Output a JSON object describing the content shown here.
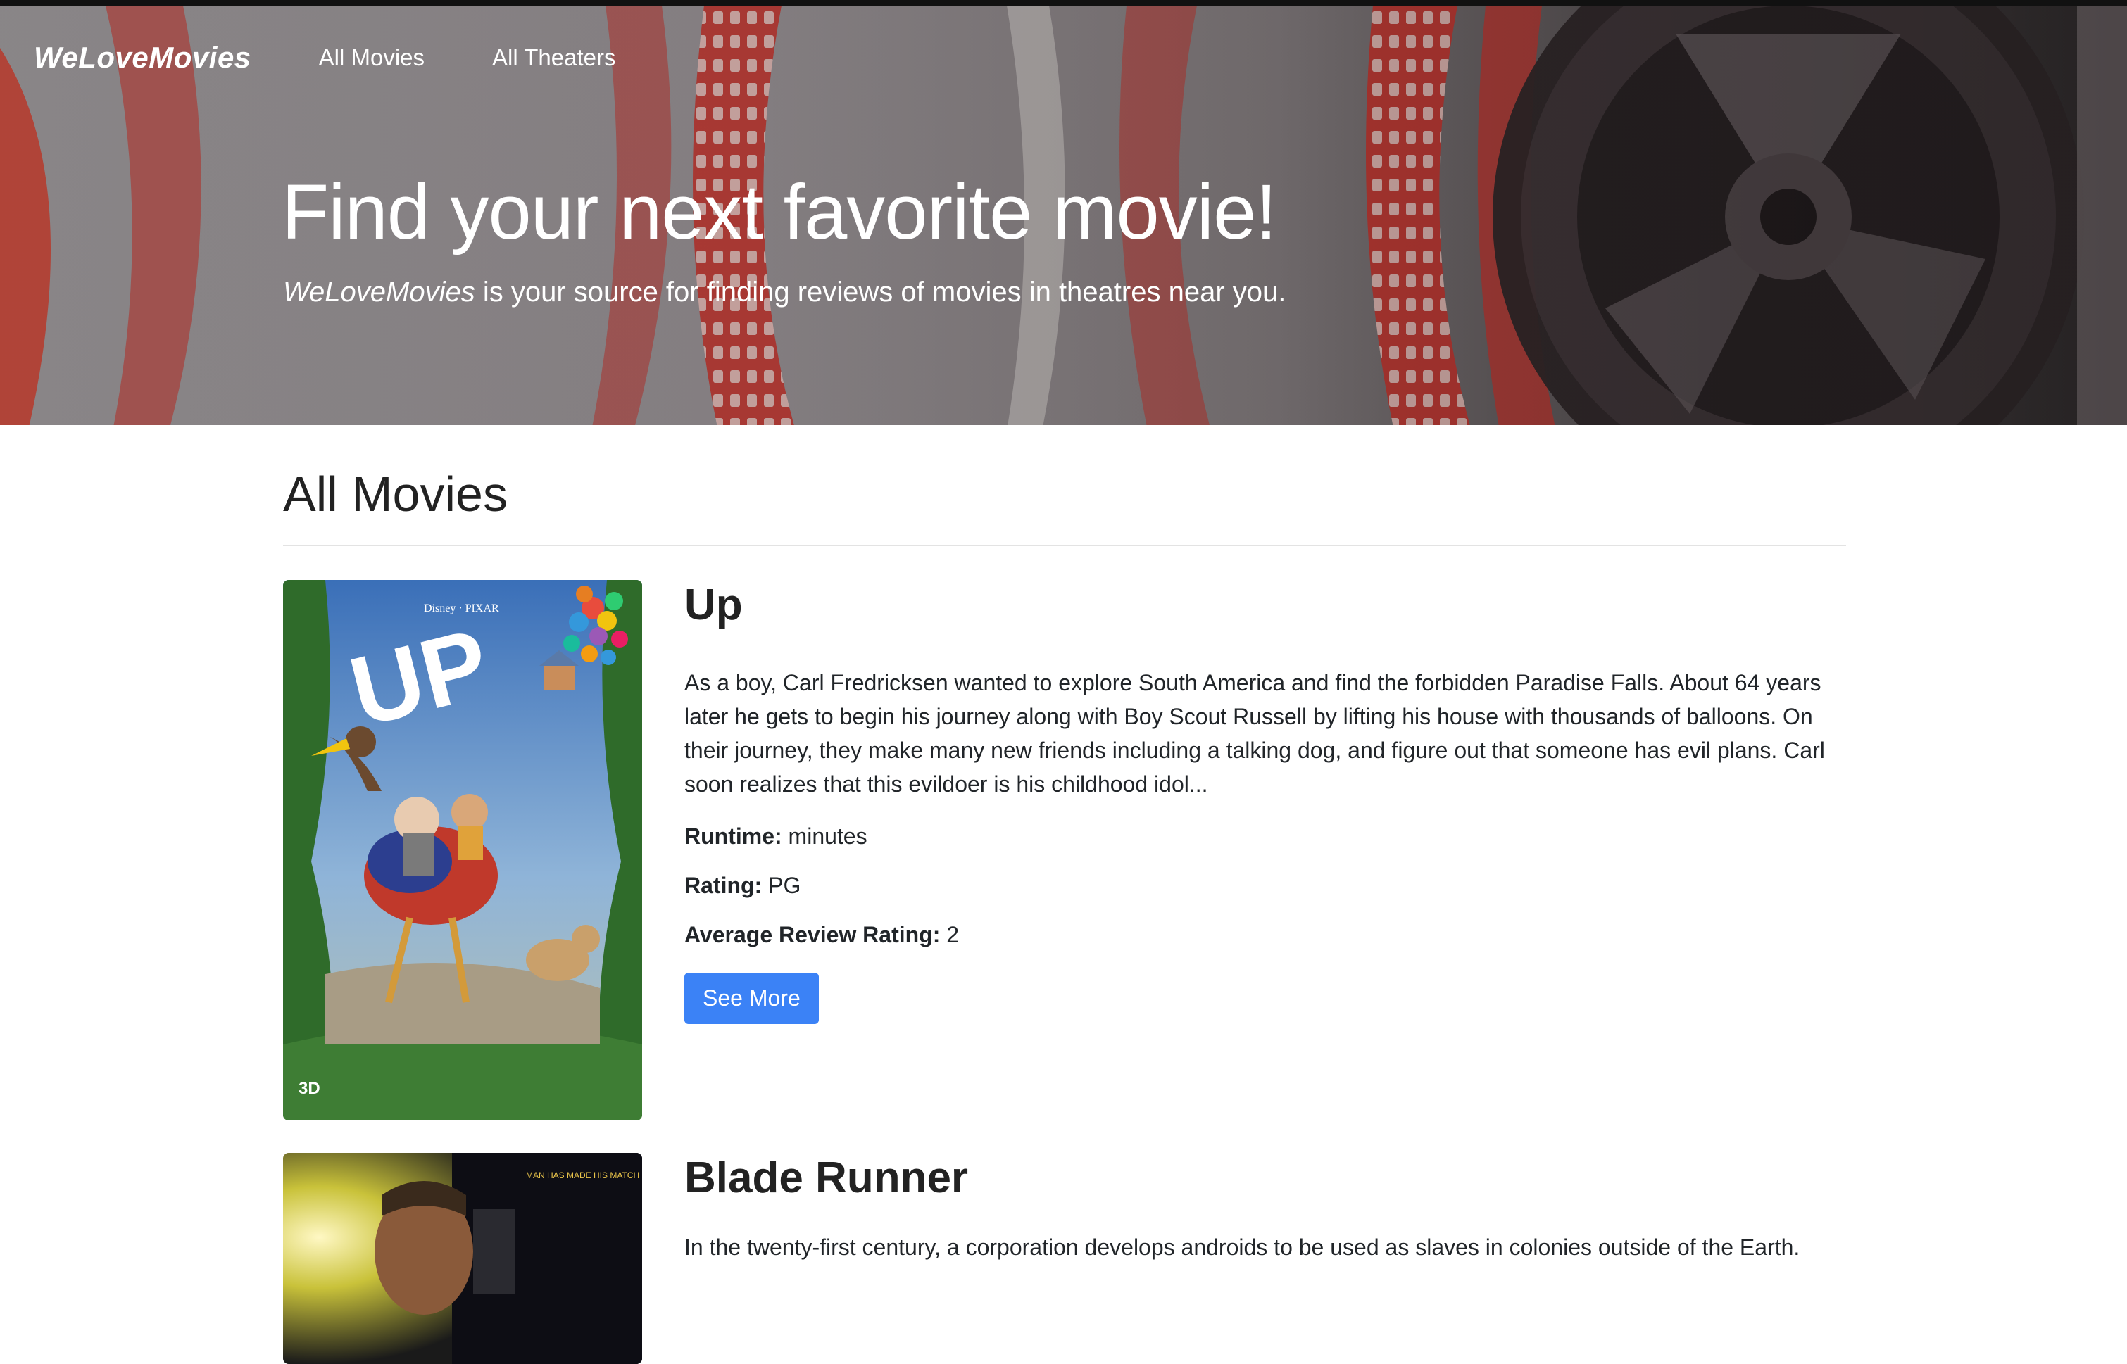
{
  "nav": {
    "brand": "WeLoveMovies",
    "links": [
      "All Movies",
      "All Theaters"
    ]
  },
  "hero": {
    "title": "Find your next favorite movie!",
    "subtitle_brand": "WeLoveMovies",
    "subtitle_rest": " is your source for finding reviews of movies in theatres near you."
  },
  "section": {
    "title": "All Movies"
  },
  "movies": [
    {
      "title": "Up",
      "description": "As a boy, Carl Fredricksen wanted to explore South America and find the forbidden Paradise Falls. About 64 years later he gets to begin his journey along with Boy Scout Russell by lifting his house with thousands of balloons. On their journey, they make many new friends including a talking dog, and figure out that someone has evil plans. Carl soon realizes that this evildoer is his childhood idol...",
      "runtime_label": "Runtime:",
      "runtime_value": " minutes",
      "rating_label": "Rating:",
      "rating_value": " PG",
      "avg_label": "Average Review Rating:",
      "avg_value": " 2",
      "button": "See More",
      "poster_text": {
        "studio": "Disney · PIXAR",
        "logo": "UP",
        "format": "3D"
      }
    },
    {
      "title": "Blade Runner",
      "description": "In the twenty-first century, a corporation develops androids to be used as slaves in colonies outside of the Earth.",
      "poster_text": {
        "tagline": "MAN HAS MADE HIS MATCH NOW IT'S HIS PROBLEM"
      }
    }
  ],
  "colors": {
    "accent": "#3b82f6",
    "film_red": "#b8322c",
    "text": "#212529"
  }
}
